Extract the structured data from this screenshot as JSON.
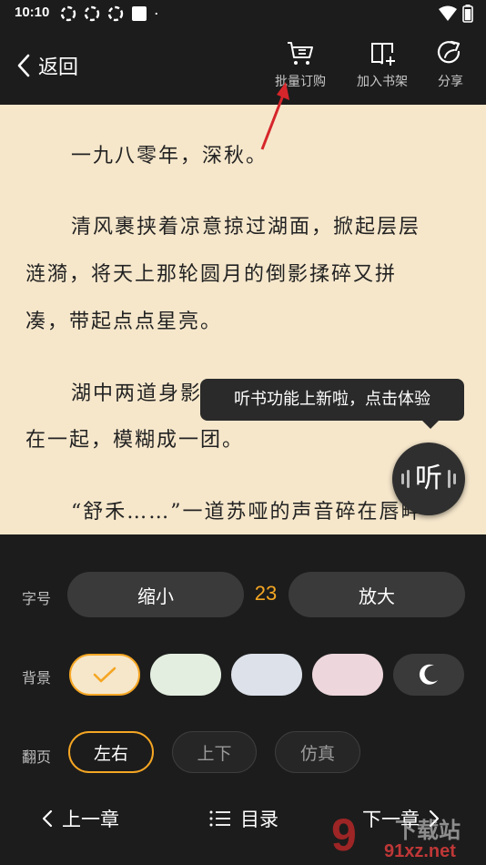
{
  "status": {
    "time": "10:10"
  },
  "header": {
    "back_label": "返回",
    "batch_label": "批量订购",
    "shelf_label": "加入书架",
    "share_label": "分享"
  },
  "content": {
    "paragraphs": [
      "一九八零年，深秋。",
      "清风裹挟着凉意掠过湖面，掀起层层",
      "涟漪，将天上那轮圆月的倒影揉碎又拼",
      "凑，带起点点星亮。",
      "湖中两道身影",
      "在一起，模糊成一团。",
      "“舒禾……”一道苏哑的声音碎在唇畔"
    ]
  },
  "tooltip": {
    "text": "听书功能上新啦，点击体验"
  },
  "listen_button": {
    "label": "听"
  },
  "settings": {
    "font_size": {
      "label": "字号",
      "decrease": "缩小",
      "value": "23",
      "increase": "放大"
    },
    "background": {
      "label": "背景",
      "colors": [
        "#f6e7cb",
        "#e3eee0",
        "#dce1ea",
        "#edd6dc",
        "#3a3a3a"
      ],
      "selected": "#f6e7cb",
      "accent": "#f5a623"
    },
    "page_turn": {
      "label": "翻页",
      "options": [
        "左右",
        "上下",
        "仿真"
      ],
      "selected": "左右"
    }
  },
  "nav": {
    "prev": "上一章",
    "toc": "目录",
    "next": "下一章"
  },
  "watermark": {
    "logo": "9",
    "text1": "下载站",
    "text2": "91xz.net"
  }
}
